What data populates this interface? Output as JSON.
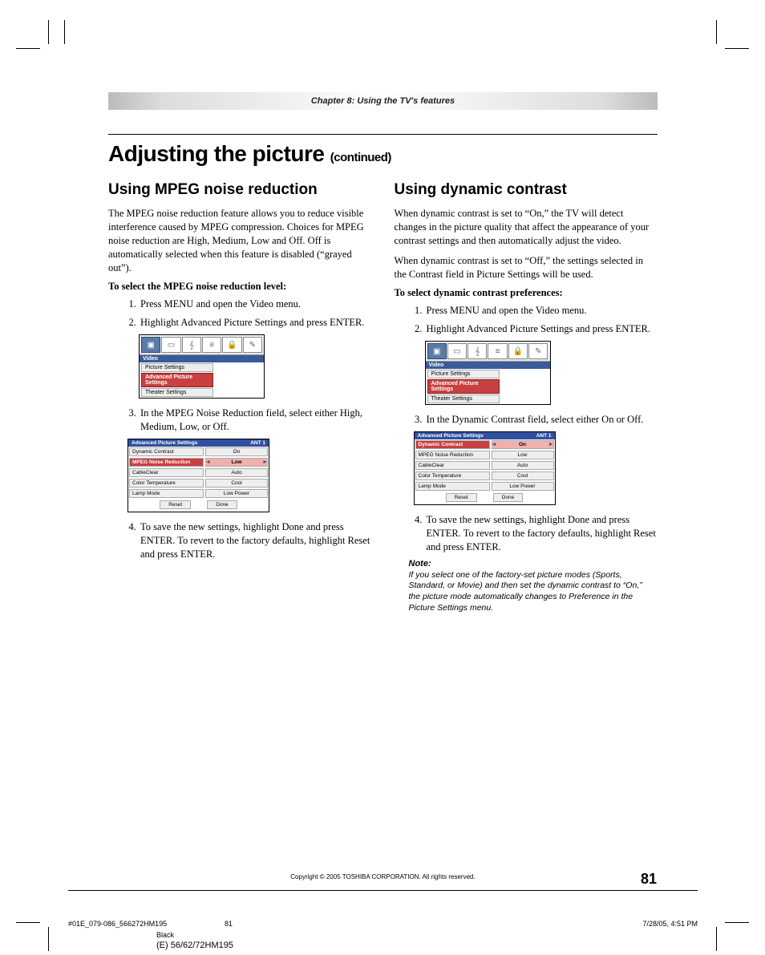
{
  "chapter_bar": "Chapter 8: Using the TV's features",
  "main_title": "Adjusting the picture",
  "main_title_suffix": "(continued)",
  "left": {
    "heading": "Using MPEG noise reduction",
    "para": "The MPEG noise reduction feature allows you to reduce visible interference caused by MPEG compression.  Choices for MPEG noise reduction are High, Medium, Low and Off. Off is automatically selected when this feature is disabled (“grayed out”).",
    "bold": "To select the MPEG noise reduction level:",
    "step1": "Press MENU and open the Video menu.",
    "step2": "Highlight Advanced Picture Settings and press ENTER.",
    "step3": "In the MPEG Noise Reduction field, select either High, Medium, Low, or Off.",
    "step4": "To save the new settings, highlight Done and press ENTER. To revert to the factory defaults, highlight Reset and press ENTER."
  },
  "right": {
    "heading": "Using dynamic contrast",
    "para1": "When dynamic contrast is set to “On,” the TV will detect changes in the picture quality that affect the appearance of your contrast settings and then automatically adjust the video.",
    "para2": "When dynamic contrast is set to “Off,” the settings selected in the Contrast field in Picture Settings will be used.",
    "bold": "To select dynamic contrast preferences:",
    "step1": "Press MENU and open the Video menu.",
    "step2": "Highlight Advanced Picture Settings and press ENTER.",
    "step3": "In the Dynamic Contrast field, select either On or Off.",
    "step4": "To save the new settings, highlight Done and press ENTER. To revert to the factory defaults, highlight Reset and press ENTER.",
    "note_head": "Note:",
    "note_body": "If you select one of the factory-set picture modes (Sports, Standard, or Movie) and then set the dynamic contrast to “On,” the picture mode automatically changes to Preference in the Picture Settings menu."
  },
  "osd_video": {
    "label": "Video",
    "items": [
      "Picture Settings",
      "Advanced Picture Settings",
      "Theater Settings"
    ],
    "selected": 1
  },
  "osd_adv": {
    "title": "Advanced Picture Settings",
    "ant": "ANT 1",
    "rows": [
      {
        "k": "Dynamic Contrast",
        "v": "On"
      },
      {
        "k": "MPEG Noise Reduction",
        "v": "Low"
      },
      {
        "k": "CableClear",
        "v": "Auto"
      },
      {
        "k": "Color Temperature",
        "v": "Cool"
      },
      {
        "k": "Lamp Mode",
        "v": "Low Power"
      }
    ],
    "btn_reset": "Reset",
    "btn_done": "Done"
  },
  "left_sel_row": 1,
  "right_sel_row": 0,
  "footer_copy": "Copyright © 2005 TOSHIBA CORPORATION. All rights reserved.",
  "page_num": "81",
  "imposition": {
    "file": "#01E_079-086_566272HM195",
    "pg": "81",
    "date": "7/28/05, 4:51 PM",
    "color": "Black",
    "model": "(E) 56/62/72HM195"
  }
}
